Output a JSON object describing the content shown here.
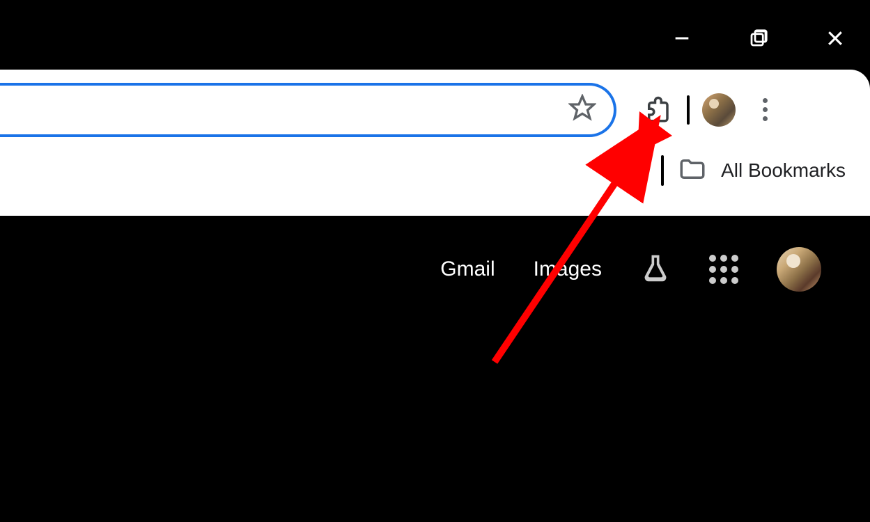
{
  "window": {
    "minimize": "minimize",
    "maximize": "maximize",
    "close": "close"
  },
  "toolbar": {
    "bookmark_star": "star-icon",
    "extensions": "extensions-icon",
    "profile": "profile-avatar",
    "menu": "three-dots-menu"
  },
  "bookmarks": {
    "all_label": "All Bookmarks",
    "folder": "folder-icon"
  },
  "content": {
    "gmail_label": "Gmail",
    "images_label": "Images",
    "labs": "labs-icon",
    "apps": "apps-grid",
    "avatar": "account-avatar"
  },
  "annotation": {
    "arrow_color": "#ff0000",
    "target": "extensions-button"
  }
}
